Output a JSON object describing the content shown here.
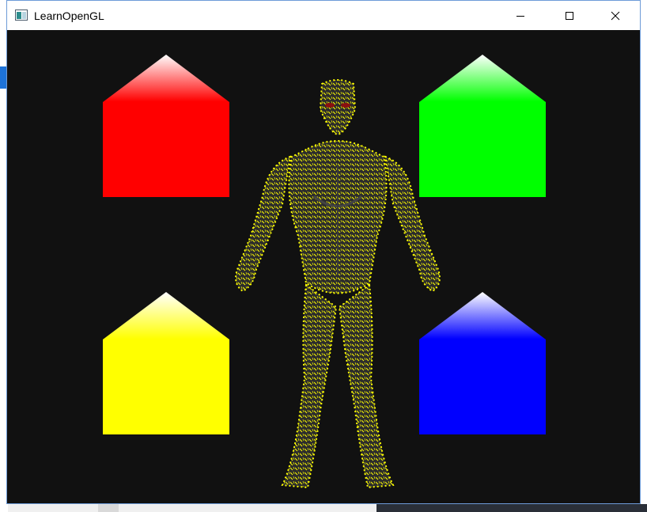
{
  "window": {
    "title": "LearnOpenGL",
    "icon": "opengl-app-icon",
    "controls": [
      "minimize-icon",
      "maximize-icon",
      "close-icon"
    ]
  },
  "scene": {
    "background_color": "#111111",
    "houses": [
      {
        "name": "red-house",
        "color": "#ff0000"
      },
      {
        "name": "green-house",
        "color": "#00ff00"
      },
      {
        "name": "yellow-house",
        "color": "#ffff00"
      },
      {
        "name": "blue-house",
        "color": "#0000ff"
      }
    ],
    "model": {
      "name": "nanosuit-normals-visualization",
      "normal_color": "#ffff00"
    }
  }
}
